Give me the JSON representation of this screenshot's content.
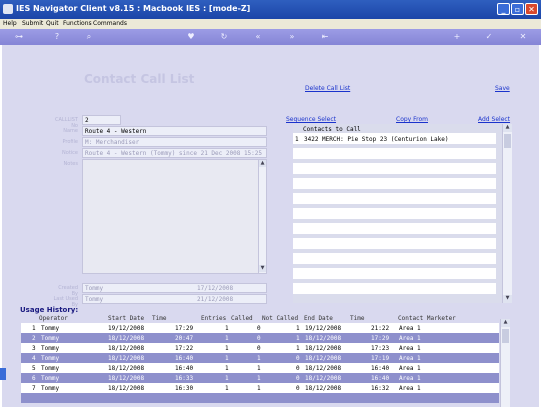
{
  "window": {
    "title": "IES Navigator Client v8.15 : Macbook IES :      [mode-Z]"
  },
  "menu": [
    "Help",
    "Submit",
    "Quit",
    "Functions",
    "Commands"
  ],
  "toolbar": {
    "icons": [
      "key-icon",
      "help-icon",
      "search-icon",
      "heart-icon",
      "refresh-icon",
      "rewind-icon",
      "fast-forward-icon",
      "first-icon",
      "add-icon",
      "check-icon",
      "close-icon"
    ]
  },
  "page": {
    "heading": "Contact Call List",
    "delete_link": "Delete Call List",
    "save_link": "Save"
  },
  "form": {
    "labels": {
      "call_list_no": "CALLLIST No",
      "name": "Name",
      "profile": "Profile",
      "notice": "Notice",
      "notes": "Notes",
      "created_by": "Created By",
      "last_used_by": "Last Used By"
    },
    "call_list_no": "2",
    "name": "Route 4 - Western",
    "profile": "M: Merchandiser",
    "notice": "Route 4 - Western (Tommy) since 21 Dec 2008 15:25",
    "notes": "",
    "created_by": "Tommy",
    "created_date": "17/12/2008",
    "last_used_by": "Tommy",
    "last_used_date": "21/12/2008"
  },
  "contacts": {
    "sequence_select": "Sequence Select",
    "copy_from": "Copy From",
    "add_select": "Add Select",
    "header": "Contacts to Call",
    "rows": [
      {
        "num": "1",
        "text": "3422 MERCH: Pie Stop 23 (Centurion Lake)"
      }
    ]
  },
  "usage": {
    "title": "Usage History:",
    "columns": [
      "Operator",
      "Start Date",
      "Time",
      "Entries",
      "Called",
      "Not Called",
      "End Date",
      "Time",
      "Contact Marketer"
    ],
    "rows": [
      {
        "n": "1",
        "op": "Tommy",
        "sd": "19/12/2008",
        "st": "17:29",
        "e": "1",
        "c": "0",
        "nc": "1",
        "ed": "19/12/2008",
        "et": "21:22",
        "m": "Area 1"
      },
      {
        "n": "2",
        "op": "Tommy",
        "sd": "18/12/2008",
        "st": "20:47",
        "e": "1",
        "c": "0",
        "nc": "1",
        "ed": "18/12/2008",
        "et": "17:29",
        "m": "Area 1"
      },
      {
        "n": "3",
        "op": "Tommy",
        "sd": "18/12/2008",
        "st": "17:22",
        "e": "1",
        "c": "0",
        "nc": "1",
        "ed": "18/12/2008",
        "et": "17:23",
        "m": "Area 1"
      },
      {
        "n": "4",
        "op": "Tommy",
        "sd": "18/12/2008",
        "st": "16:40",
        "e": "1",
        "c": "1",
        "nc": "0",
        "ed": "18/12/2008",
        "et": "17:19",
        "m": "Area 1"
      },
      {
        "n": "5",
        "op": "Tommy",
        "sd": "18/12/2008",
        "st": "16:40",
        "e": "1",
        "c": "1",
        "nc": "0",
        "ed": "18/12/2008",
        "et": "16:40",
        "m": "Area 1"
      },
      {
        "n": "6",
        "op": "Tommy",
        "sd": "18/12/2008",
        "st": "16:33",
        "e": "1",
        "c": "1",
        "nc": "0",
        "ed": "18/12/2008",
        "et": "16:40",
        "m": "Area 1"
      },
      {
        "n": "7",
        "op": "Tommy",
        "sd": "18/12/2008",
        "st": "16:30",
        "e": "1",
        "c": "1",
        "nc": "0",
        "ed": "18/12/2008",
        "et": "16:32",
        "m": "Area 1"
      }
    ]
  },
  "colors": {
    "accent": "#1a33cc",
    "titlebar": "#1c45a8",
    "toolbar": "#8585d6",
    "page_bg": "#d9d9ef",
    "row_highlight": "#8e90cc"
  }
}
